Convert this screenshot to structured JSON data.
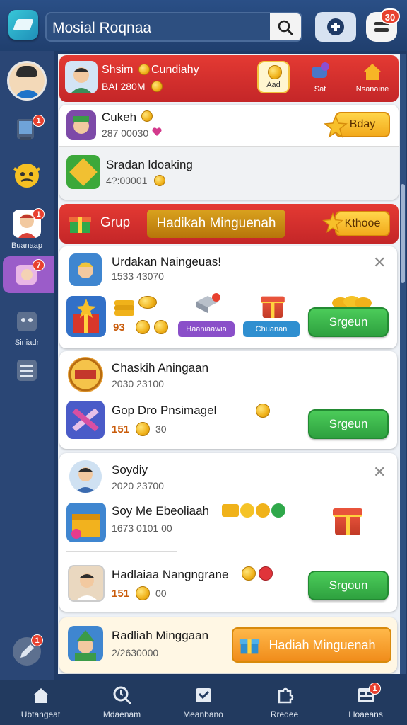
{
  "header": {
    "search_value": "Mosial Roqnaa",
    "notif_count": "30"
  },
  "sidebar": {
    "items": [
      {
        "label": "",
        "badge": "1"
      },
      {
        "label": "",
        "badge": ""
      },
      {
        "label": "Buanaap",
        "badge": "1"
      },
      {
        "label": "",
        "badge": "7"
      },
      {
        "label": "Siniadr",
        "badge": ""
      },
      {
        "label": "",
        "badge": ""
      },
      {
        "label": "",
        "badge": "1"
      }
    ]
  },
  "profile_card": {
    "name": "Shsim",
    "status": "Cundiahy",
    "code": "BAI 280M",
    "actions": [
      "Aad",
      "Sat",
      "Nsanaine"
    ]
  },
  "list_top": [
    {
      "title": "Cukeh",
      "sub": "287 00030"
    },
    {
      "title": "Sradan ldoaking",
      "sub": "4?:00001"
    }
  ],
  "bday_button": "Bday",
  "group_section": {
    "label": "Grup",
    "title": "Hadikah Minguenah",
    "button": "Kthooe"
  },
  "card1": {
    "title": "Urdakan Naingeuas!",
    "sub": "1533 43070",
    "reward_amount": "93",
    "pills": [
      "Haaniaawia",
      "Chuanan"
    ],
    "button": "Srgeun"
  },
  "card2": [
    {
      "title": "Chaskih Aningaan",
      "sub": "2030 23100"
    },
    {
      "title": "Gop Dro Pnsimagel",
      "amount": "151",
      "amount2": "30",
      "button": "Srgeun"
    }
  ],
  "card3": {
    "user": "Soydiy",
    "user_sub": "2020 23700",
    "item_title": "Soy Me Ebeoliaah",
    "item_sub": "1673 0101 00",
    "row_title": "Hadlaiaa Nangngrane",
    "amount": "151",
    "amount2": "00",
    "button": "Srgoun"
  },
  "card4": {
    "title": "Radliah Minggaan",
    "sub": "2/2630000",
    "button": "Hadiah Minguenah"
  },
  "bottom_nav": [
    {
      "label": "Ubtangeat",
      "icon": "home-icon",
      "badge": ""
    },
    {
      "label": "Mdaenam",
      "icon": "search-clock-icon",
      "badge": ""
    },
    {
      "label": "Meanbano",
      "icon": "message-icon",
      "badge": ""
    },
    {
      "label": "Rredee",
      "icon": "puzzle-icon",
      "badge": ""
    },
    {
      "label": "I loaeans",
      "icon": "grid-icon",
      "badge": "1"
    }
  ],
  "colors": {
    "primary_dark": "#203f6e",
    "accent_red": "#d42f2d",
    "accent_green": "#34a844",
    "accent_yellow": "#f2b21e"
  }
}
